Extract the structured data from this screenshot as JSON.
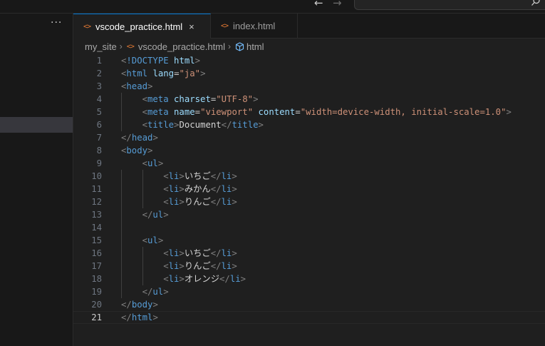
{
  "titlebar": {
    "back_glyph": "←",
    "forward_glyph": "→"
  },
  "sidebar": {
    "more_glyph": "···"
  },
  "tabs": [
    {
      "label": "vscode_practice.html",
      "icon": "<>",
      "active": true,
      "close_glyph": "×"
    },
    {
      "label": "index.html",
      "icon": "<>",
      "active": false
    }
  ],
  "breadcrumb": {
    "folder": "my_site",
    "file": "vscode_practice.html",
    "file_icon": "<>",
    "symbol": "html",
    "separator": "›"
  },
  "editor": {
    "current_line": 21,
    "lines": [
      {
        "n": "1",
        "indent": 0,
        "tokens": [
          [
            "br",
            "<"
          ],
          [
            "tag",
            "!DOCTYPE"
          ],
          [
            "text",
            " "
          ],
          [
            "attr",
            "html"
          ],
          [
            "br",
            ">"
          ]
        ]
      },
      {
        "n": "2",
        "indent": 0,
        "tokens": [
          [
            "br",
            "<"
          ],
          [
            "tag",
            "html"
          ],
          [
            "text",
            " "
          ],
          [
            "attr",
            "lang"
          ],
          [
            "eq",
            "="
          ],
          [
            "str",
            "\"ja\""
          ],
          [
            "br",
            ">"
          ]
        ]
      },
      {
        "n": "3",
        "indent": 0,
        "tokens": [
          [
            "br",
            "<"
          ],
          [
            "tag",
            "head"
          ],
          [
            "br",
            ">"
          ]
        ]
      },
      {
        "n": "4",
        "indent": 1,
        "tokens": [
          [
            "br",
            "<"
          ],
          [
            "tag",
            "meta"
          ],
          [
            "text",
            " "
          ],
          [
            "attr",
            "charset"
          ],
          [
            "eq",
            "="
          ],
          [
            "str",
            "\"UTF-8\""
          ],
          [
            "br",
            ">"
          ]
        ]
      },
      {
        "n": "5",
        "indent": 1,
        "tokens": [
          [
            "br",
            "<"
          ],
          [
            "tag",
            "meta"
          ],
          [
            "text",
            " "
          ],
          [
            "attr",
            "name"
          ],
          [
            "eq",
            "="
          ],
          [
            "str",
            "\"viewport\""
          ],
          [
            "text",
            " "
          ],
          [
            "attr",
            "content"
          ],
          [
            "eq",
            "="
          ],
          [
            "str",
            "\"width=device-width, initial-scale=1.0\""
          ],
          [
            "br",
            ">"
          ]
        ]
      },
      {
        "n": "6",
        "indent": 1,
        "tokens": [
          [
            "br",
            "<"
          ],
          [
            "tag",
            "title"
          ],
          [
            "br",
            ">"
          ],
          [
            "text",
            "Document"
          ],
          [
            "br",
            "</"
          ],
          [
            "tag",
            "title"
          ],
          [
            "br",
            ">"
          ]
        ]
      },
      {
        "n": "7",
        "indent": 0,
        "tokens": [
          [
            "br",
            "</"
          ],
          [
            "tag",
            "head"
          ],
          [
            "br",
            ">"
          ]
        ]
      },
      {
        "n": "8",
        "indent": 0,
        "tokens": [
          [
            "br",
            "<"
          ],
          [
            "tag",
            "body"
          ],
          [
            "br",
            ">"
          ]
        ]
      },
      {
        "n": "9",
        "indent": 1,
        "tokens": [
          [
            "br",
            "<"
          ],
          [
            "tag",
            "ul"
          ],
          [
            "br",
            ">"
          ]
        ]
      },
      {
        "n": "10",
        "indent": 2,
        "tokens": [
          [
            "br",
            "<"
          ],
          [
            "tag",
            "li"
          ],
          [
            "br",
            ">"
          ],
          [
            "text",
            "いちご"
          ],
          [
            "br",
            "</"
          ],
          [
            "tag",
            "li"
          ],
          [
            "br",
            ">"
          ]
        ]
      },
      {
        "n": "11",
        "indent": 2,
        "tokens": [
          [
            "br",
            "<"
          ],
          [
            "tag",
            "li"
          ],
          [
            "br",
            ">"
          ],
          [
            "text",
            "みかん"
          ],
          [
            "br",
            "</"
          ],
          [
            "tag",
            "li"
          ],
          [
            "br",
            ">"
          ]
        ]
      },
      {
        "n": "12",
        "indent": 2,
        "tokens": [
          [
            "br",
            "<"
          ],
          [
            "tag",
            "li"
          ],
          [
            "br",
            ">"
          ],
          [
            "text",
            "りんご"
          ],
          [
            "br",
            "</"
          ],
          [
            "tag",
            "li"
          ],
          [
            "br",
            ">"
          ]
        ]
      },
      {
        "n": "13",
        "indent": 1,
        "tokens": [
          [
            "br",
            "</"
          ],
          [
            "tag",
            "ul"
          ],
          [
            "br",
            ">"
          ]
        ]
      },
      {
        "n": "14",
        "indent": 0,
        "tokens": []
      },
      {
        "n": "15",
        "indent": 1,
        "tokens": [
          [
            "br",
            "<"
          ],
          [
            "tag",
            "ul"
          ],
          [
            "br",
            ">"
          ]
        ]
      },
      {
        "n": "16",
        "indent": 2,
        "tokens": [
          [
            "br",
            "<"
          ],
          [
            "tag",
            "li"
          ],
          [
            "br",
            ">"
          ],
          [
            "text",
            "いちご"
          ],
          [
            "br",
            "</"
          ],
          [
            "tag",
            "li"
          ],
          [
            "br",
            ">"
          ]
        ]
      },
      {
        "n": "17",
        "indent": 2,
        "tokens": [
          [
            "br",
            "<"
          ],
          [
            "tag",
            "li"
          ],
          [
            "br",
            ">"
          ],
          [
            "text",
            "りんご"
          ],
          [
            "br",
            "</"
          ],
          [
            "tag",
            "li"
          ],
          [
            "br",
            ">"
          ]
        ]
      },
      {
        "n": "18",
        "indent": 2,
        "tokens": [
          [
            "br",
            "<"
          ],
          [
            "tag",
            "li"
          ],
          [
            "br",
            ">"
          ],
          [
            "text",
            "オレンジ"
          ],
          [
            "br",
            "</"
          ],
          [
            "tag",
            "li"
          ],
          [
            "br",
            ">"
          ]
        ]
      },
      {
        "n": "19",
        "indent": 1,
        "tokens": [
          [
            "br",
            "</"
          ],
          [
            "tag",
            "ul"
          ],
          [
            "br",
            ">"
          ]
        ]
      },
      {
        "n": "20",
        "indent": 0,
        "tokens": [
          [
            "br",
            "</"
          ],
          [
            "tag",
            "body"
          ],
          [
            "br",
            ">"
          ]
        ]
      },
      {
        "n": "21",
        "indent": 0,
        "tokens": [
          [
            "br",
            "</"
          ],
          [
            "tag",
            "html"
          ],
          [
            "br",
            ">"
          ]
        ]
      }
    ]
  },
  "colors": {
    "background": "#1f1f1f",
    "accent": "#0078d4",
    "tag": "#569cd6",
    "attribute": "#9cdcfe",
    "string": "#ce9178",
    "bracket": "#808080",
    "html_file_icon": "#e37933"
  },
  "icons": [
    "search-icon",
    "html-file-icon",
    "symbol-element-icon",
    "close-icon",
    "more-actions-icon",
    "arrow-left-icon",
    "arrow-right-icon"
  ]
}
